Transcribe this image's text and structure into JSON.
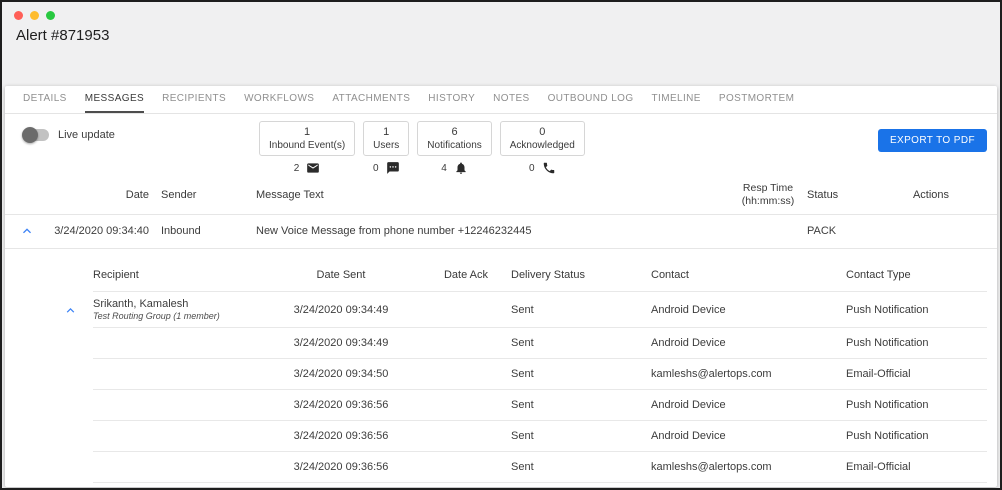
{
  "window": {
    "title": "Alert #871953"
  },
  "colors": {
    "accent": "#1a73e8",
    "chevron": "#3b82f6",
    "light-red": "#ff5f57",
    "light-yellow": "#febc2e",
    "light-green": "#28c840"
  },
  "tabs": [
    {
      "label": "DETAILS",
      "active": false
    },
    {
      "label": "MESSAGES",
      "active": true
    },
    {
      "label": "RECIPIENTS",
      "active": false
    },
    {
      "label": "WORKFLOWS",
      "active": false
    },
    {
      "label": "ATTACHMENTS",
      "active": false
    },
    {
      "label": "HISTORY",
      "active": false
    },
    {
      "label": "NOTES",
      "active": false
    },
    {
      "label": "OUTBOUND LOG",
      "active": false
    },
    {
      "label": "TIMELINE",
      "active": false
    },
    {
      "label": "POSTMORTEM",
      "active": false
    }
  ],
  "toolbar": {
    "live_update_label": "Live update",
    "export_button_label": "EXPORT TO PDF"
  },
  "stats": [
    {
      "value": "1",
      "label": "Inbound Event(s)",
      "counter": "2",
      "icon": "envelope-icon"
    },
    {
      "value": "1",
      "label": "Users",
      "counter": "0",
      "icon": "chat-icon"
    },
    {
      "value": "6",
      "label": "Notifications",
      "counter": "4",
      "icon": "bell-icon"
    },
    {
      "value": "0",
      "label": "Acknowledged",
      "counter": "0",
      "icon": "phone-icon"
    }
  ],
  "message_table": {
    "headers": {
      "date": "Date",
      "sender": "Sender",
      "message": "Message Text",
      "resp_time_line1": "Resp Time",
      "resp_time_line2": "(hh:mm:ss)",
      "status": "Status",
      "actions": "Actions"
    },
    "rows": [
      {
        "date": "3/24/2020 09:34:40",
        "sender": "Inbound",
        "message": "New Voice Message from phone number +12246232445",
        "resp_time": "",
        "status": "PACK",
        "actions": ""
      }
    ]
  },
  "detail_table": {
    "headers": [
      "Recipient",
      "Date Sent",
      "Date Ack",
      "Delivery Status",
      "Contact",
      "Contact Type"
    ],
    "rows": [
      {
        "recipient": "Srikanth, Kamalesh",
        "recipient_sub": "Test Routing Group (1 member)",
        "date_sent": "3/24/2020 09:34:49",
        "date_ack": "",
        "delivery_status": "Sent",
        "contact": "Android Device",
        "contact_type": "Push Notification"
      },
      {
        "recipient": "",
        "recipient_sub": "",
        "date_sent": "3/24/2020 09:34:49",
        "date_ack": "",
        "delivery_status": "Sent",
        "contact": "Android Device",
        "contact_type": "Push Notification"
      },
      {
        "recipient": "",
        "recipient_sub": "",
        "date_sent": "3/24/2020 09:34:50",
        "date_ack": "",
        "delivery_status": "Sent",
        "contact": "kamleshs@alertops.com",
        "contact_type": "Email-Official"
      },
      {
        "recipient": "",
        "recipient_sub": "",
        "date_sent": "3/24/2020 09:36:56",
        "date_ack": "",
        "delivery_status": "Sent",
        "contact": "Android Device",
        "contact_type": "Push Notification"
      },
      {
        "recipient": "",
        "recipient_sub": "",
        "date_sent": "3/24/2020 09:36:56",
        "date_ack": "",
        "delivery_status": "Sent",
        "contact": "Android Device",
        "contact_type": "Push Notification"
      },
      {
        "recipient": "",
        "recipient_sub": "",
        "date_sent": "3/24/2020 09:36:56",
        "date_ack": "",
        "delivery_status": "Sent",
        "contact": "kamleshs@alertops.com",
        "contact_type": "Email-Official"
      }
    ]
  }
}
